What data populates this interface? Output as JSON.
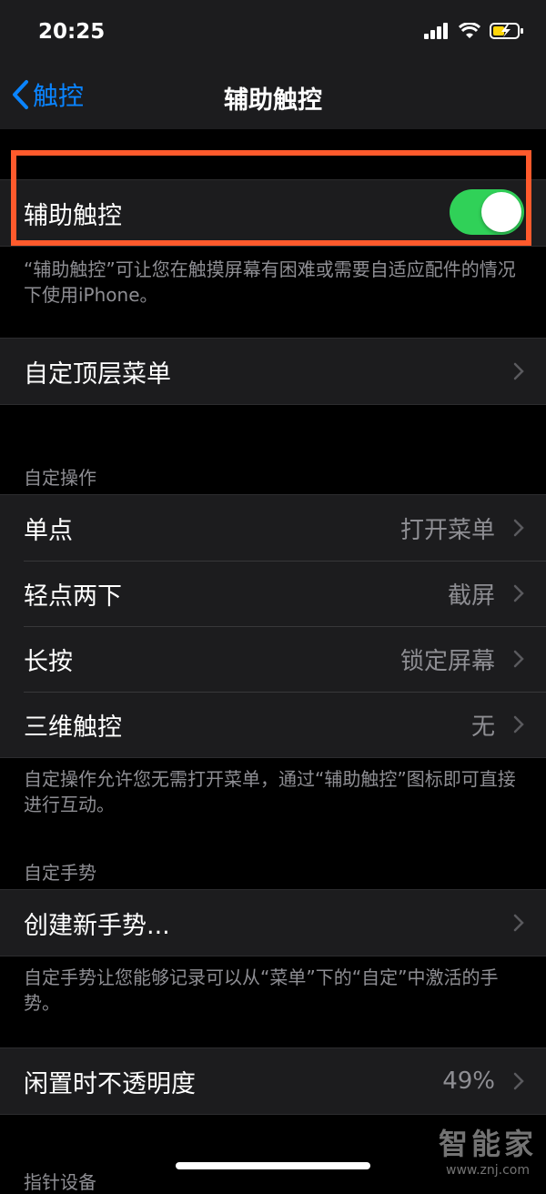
{
  "status": {
    "time": "20:25"
  },
  "nav": {
    "back_label": "触控",
    "title": "辅助触控"
  },
  "main_toggle": {
    "label": "辅助触控",
    "enabled": true
  },
  "main_footnote": "“辅助触控”可让您在触摸屏幕有困难或需要自适应配件的情况下使用iPhone。",
  "custom_menu": {
    "label": "自定顶层菜单"
  },
  "custom_actions": {
    "header": "自定操作",
    "rows": [
      {
        "label": "单点",
        "value": "打开菜单"
      },
      {
        "label": "轻点两下",
        "value": "截屏"
      },
      {
        "label": "长按",
        "value": "锁定屏幕"
      },
      {
        "label": "三维触控",
        "value": "无"
      }
    ],
    "footnote": "自定操作允许您无需打开菜单，通过“辅助触控”图标即可直接进行互动。"
  },
  "custom_gestures": {
    "header": "自定手势",
    "create_label": "创建新手势...",
    "footnote": "自定手势让您能够记录可以从“菜单”下的“自定”中激活的手势。"
  },
  "idle_opacity": {
    "label": "闲置时不透明度",
    "value": "49%"
  },
  "pointer_header": "指针设备",
  "watermark": {
    "logo": "智能家",
    "url": "www.znj.com"
  },
  "colors": {
    "accent": "#0a84ff",
    "toggle_on": "#30d158",
    "highlight": "#ff5a2c"
  }
}
